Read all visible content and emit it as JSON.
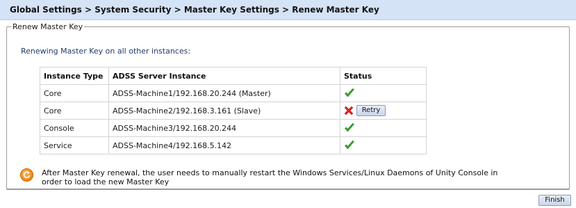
{
  "breadcrumb": "Global Settings > System Security > Master Key Settings > Renew Master Key",
  "panel": {
    "legend": "Renew Master Key",
    "intro": "Renewing Master Key on all other instances:"
  },
  "table": {
    "headers": [
      "Instance Type",
      "ADSS Server Instance",
      "Status"
    ],
    "rows": [
      {
        "type": "Core",
        "instance": "ADSS-Machine1/192.168.20.244 (Master)",
        "status": "success"
      },
      {
        "type": "Core",
        "instance": "ADSS-Machine2/192.168.3.161 (Slave)",
        "status": "failed",
        "action": "Retry"
      },
      {
        "type": "Console",
        "instance": "ADSS-Machine3/192.168.20.244",
        "status": "success"
      },
      {
        "type": "Service",
        "instance": "ADSS-Machine4/192.168.5.142",
        "status": "success"
      }
    ]
  },
  "note": "After Master Key renewal, the user needs to manually restart the Windows Services/Linux Daemons of Unity Console in order to load the new Master Key",
  "buttons": {
    "finish": "Finish"
  },
  "icons": {
    "success": "checkmark-icon",
    "failed": "red-x-icon",
    "note": "orange-refresh-icon"
  },
  "colors": {
    "header_bg": "#d5e3f6",
    "success": "#3da52d",
    "failed": "#e0201b",
    "note_icon": "#e8760a"
  }
}
